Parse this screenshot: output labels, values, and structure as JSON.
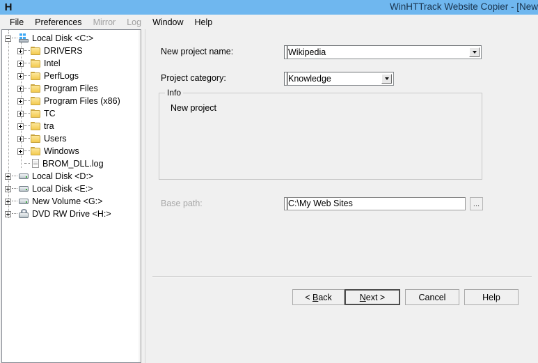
{
  "window": {
    "app_icon": "H",
    "title": "WinHTTrack Website Copier - [New ",
    "title_bar_color": "#6fb7ef"
  },
  "menubar": {
    "items": [
      {
        "label": "File",
        "disabled": false
      },
      {
        "label": "Preferences",
        "disabled": false
      },
      {
        "label": "Mirror",
        "disabled": true
      },
      {
        "label": "Log",
        "disabled": true
      },
      {
        "label": "Window",
        "disabled": false
      },
      {
        "label": "Help",
        "disabled": false
      }
    ]
  },
  "tree": {
    "items": [
      {
        "label": "Local Disk <C:>",
        "icon": "windows-drive-icon",
        "expander": "minus",
        "depth": 0
      },
      {
        "label": "DRIVERS",
        "icon": "folder-icon",
        "expander": "plus",
        "depth": 1
      },
      {
        "label": "Intel",
        "icon": "folder-icon",
        "expander": "plus",
        "depth": 1
      },
      {
        "label": "PerfLogs",
        "icon": "folder-icon",
        "expander": "plus",
        "depth": 1
      },
      {
        "label": "Program Files",
        "icon": "folder-icon",
        "expander": "plus",
        "depth": 1
      },
      {
        "label": "Program Files (x86)",
        "icon": "folder-icon",
        "expander": "plus",
        "depth": 1
      },
      {
        "label": "TC",
        "icon": "folder-icon",
        "expander": "plus",
        "depth": 1
      },
      {
        "label": "tra",
        "icon": "folder-icon",
        "expander": "plus",
        "depth": 1
      },
      {
        "label": "Users",
        "icon": "folder-icon",
        "expander": "plus",
        "depth": 1
      },
      {
        "label": "Windows",
        "icon": "folder-icon",
        "expander": "plus",
        "depth": 1
      },
      {
        "label": "BROM_DLL.log",
        "icon": "file-icon",
        "expander": "none",
        "depth": 1
      },
      {
        "label": "Local Disk <D:>",
        "icon": "drive-icon",
        "expander": "plus",
        "depth": 0
      },
      {
        "label": "Local Disk <E:>",
        "icon": "drive-icon",
        "expander": "plus",
        "depth": 0
      },
      {
        "label": "New Volume <G:>",
        "icon": "drive-icon",
        "expander": "plus",
        "depth": 0
      },
      {
        "label": "DVD RW Drive <H:>",
        "icon": "dvd-drive-icon",
        "expander": "plus",
        "depth": 0
      }
    ]
  },
  "form": {
    "project_name_label": "New project name:",
    "project_name_value": "Wikipedia",
    "project_category_label": "Project category:",
    "project_category_value": "Knowledge",
    "info_group_title": "Info",
    "info_text": "New project",
    "base_path_label": "Base path:",
    "base_path_value": "C:\\My Web Sites",
    "browse_label": "..."
  },
  "buttons": {
    "back": {
      "pre": "< ",
      "accel": "B",
      "post": "ack"
    },
    "next": {
      "pre": "",
      "accel": "N",
      "post": "ext >"
    },
    "cancel": "Cancel",
    "help": "Help"
  }
}
